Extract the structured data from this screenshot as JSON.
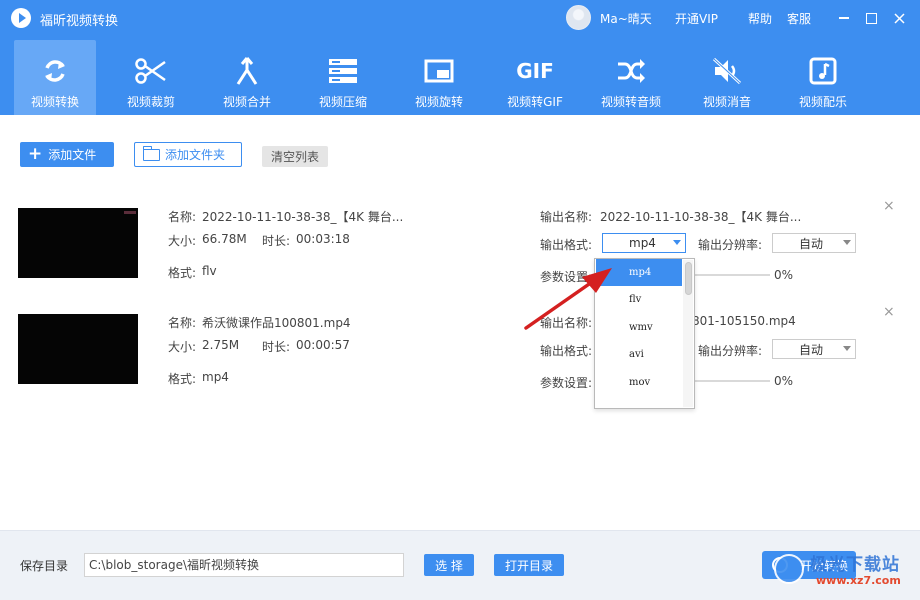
{
  "app": {
    "title": "福昕视频转换",
    "username": "Ma~晴天",
    "vip_label": "开通VIP",
    "help_label": "帮助",
    "service_label": "客服"
  },
  "toolbar": {
    "items": [
      {
        "label": "视频转换",
        "icon": "convert-icon",
        "active": true
      },
      {
        "label": "视频裁剪",
        "icon": "scissors-icon"
      },
      {
        "label": "视频合并",
        "icon": "merge-icon"
      },
      {
        "label": "视频压缩",
        "icon": "compress-icon"
      },
      {
        "label": "视频旋转",
        "icon": "rotate-icon"
      },
      {
        "label": "视频转GIF",
        "icon": "gif-icon",
        "icon_text": "GIF"
      },
      {
        "label": "视频转音频",
        "icon": "shuffle-icon"
      },
      {
        "label": "视频消音",
        "icon": "mute-icon"
      },
      {
        "label": "视频配乐",
        "icon": "music-icon"
      }
    ]
  },
  "actions": {
    "add_file": "添加文件",
    "add_folder": "添加文件夹",
    "clear_list": "清空列表"
  },
  "labels": {
    "name": "名称:",
    "size": "大小:",
    "duration": "时长:",
    "format": "格式:",
    "output_name": "输出名称:",
    "output_format": "输出格式:",
    "output_resolution": "输出分辨率:",
    "params": "参数设置:"
  },
  "files": [
    {
      "name": "2022-10-11-10-38-38_【4K 舞台...",
      "size": "66.78M",
      "duration": "00:03:18",
      "format": "flv",
      "output_name": "2022-10-11-10-38-38_【4K 舞台...",
      "output_format": "mp4",
      "resolution": "自动",
      "progress": "0%"
    },
    {
      "name": "希沃微课作品100801.mp4",
      "size": "2.75M",
      "duration": "00:00:57",
      "format": "mp4",
      "output_name_visible": "801-105150.mp4",
      "resolution": "自动",
      "progress": "0%"
    }
  ],
  "dropdown": {
    "options": [
      "mp4",
      "flv",
      "wmv",
      "avi",
      "mov"
    ],
    "selected": "mp4"
  },
  "bottom": {
    "save_dir_label": "保存目录",
    "save_path": "C:\\blob_storage\\福昕视频转换",
    "choose_label": "选 择",
    "open_dir_label": "打开目录",
    "start_label": "开始转换"
  },
  "watermark": {
    "line1": "极光下载站",
    "line2": "www.xz7.com"
  },
  "colors": {
    "primary": "#3d8ef0",
    "active_tab": "#67a8f6",
    "annotation": "#e02020"
  }
}
